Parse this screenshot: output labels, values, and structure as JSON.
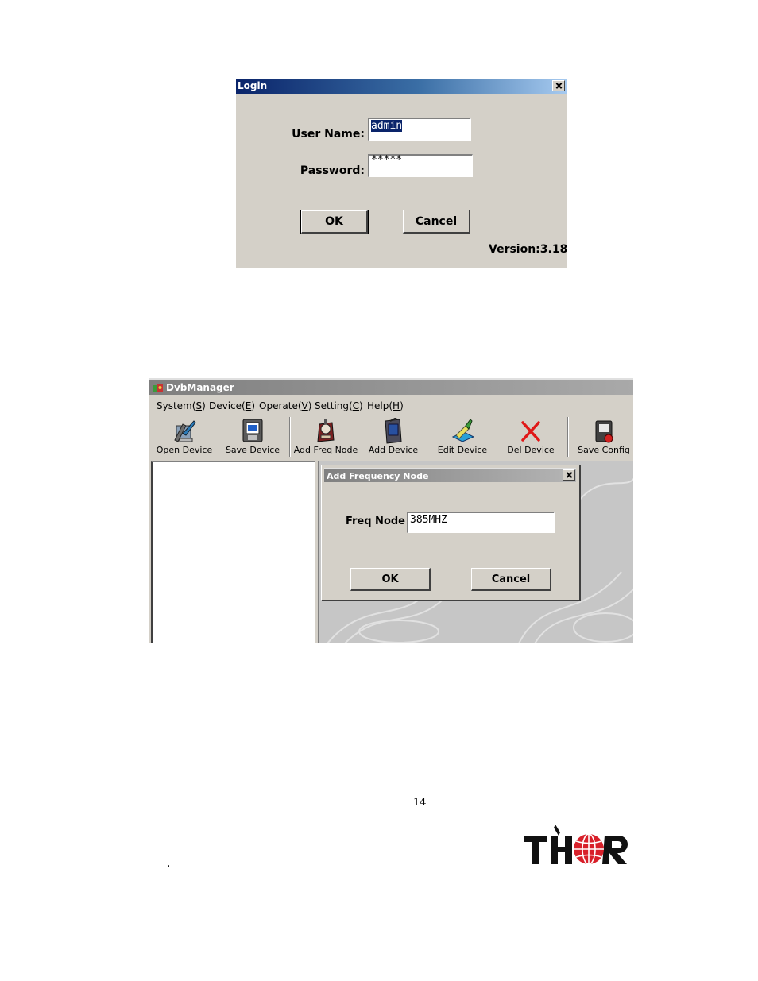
{
  "login": {
    "title": "Login",
    "username_label": "User Name:",
    "username_value": "admin",
    "password_label": "Password:",
    "password_value": "*****",
    "ok_label": "OK",
    "cancel_label": "Cancel",
    "version": "Version:3.18"
  },
  "dvb": {
    "title": "DvbManager",
    "menu": [
      {
        "text": "System(",
        "key": "S",
        "tail": ")"
      },
      {
        "text": "Device(",
        "key": "E",
        "tail": ")"
      },
      {
        "text": "Operate(",
        "key": "V",
        "tail": ")"
      },
      {
        "text": "Setting(",
        "key": "C",
        "tail": ")"
      },
      {
        "text": "Help(",
        "key": "H",
        "tail": ")"
      }
    ],
    "toolbar": [
      {
        "label": "Open Device",
        "icon": "open-device-icon"
      },
      {
        "label": "Save Device",
        "icon": "save-device-icon"
      },
      {
        "label": "Add Freq Node",
        "icon": "add-freq-node-icon"
      },
      {
        "label": "Add Device",
        "icon": "add-device-icon"
      },
      {
        "label": "Edit Device",
        "icon": "edit-device-icon"
      },
      {
        "label": "Del Device",
        "icon": "del-device-icon"
      },
      {
        "label": "Save Config",
        "icon": "save-config-icon"
      }
    ],
    "dialog": {
      "title": "Add Frequency Node",
      "freq_label": "Freq Node",
      "freq_value": "385MHZ",
      "ok_label": "OK",
      "cancel_label": "Cancel"
    }
  },
  "footer": {
    "page_number": "14",
    "dot": "."
  },
  "colors": {
    "dialog_face": "#d4d0c8",
    "active_title": "#0a246a",
    "logo_red": "#d8202a"
  }
}
